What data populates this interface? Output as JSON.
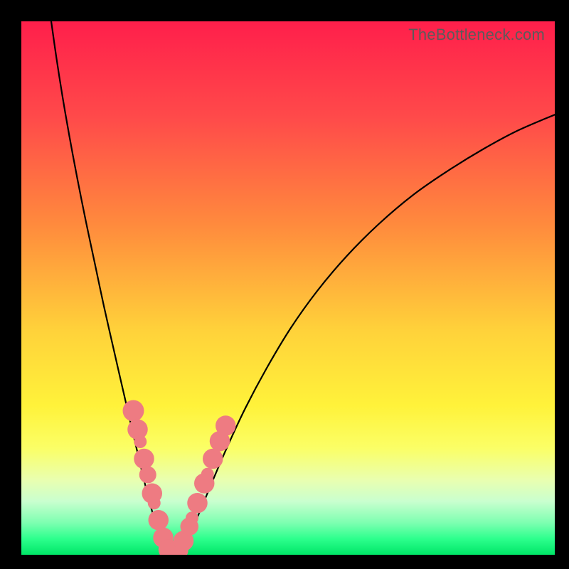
{
  "watermark": "TheBottleneck.com",
  "chart_data": {
    "type": "line",
    "title": "",
    "xlabel": "",
    "ylabel": "",
    "xlim": [
      0,
      100
    ],
    "ylim": [
      0,
      100
    ],
    "gradient_stops": [
      {
        "offset": 0.0,
        "color": "#ff1f4b"
      },
      {
        "offset": 0.18,
        "color": "#ff4a4a"
      },
      {
        "offset": 0.38,
        "color": "#ff8a3d"
      },
      {
        "offset": 0.58,
        "color": "#ffd23a"
      },
      {
        "offset": 0.72,
        "color": "#fff23a"
      },
      {
        "offset": 0.8,
        "color": "#fbff66"
      },
      {
        "offset": 0.86,
        "color": "#e9ffb0"
      },
      {
        "offset": 0.9,
        "color": "#c9ffcf"
      },
      {
        "offset": 0.94,
        "color": "#7dffb1"
      },
      {
        "offset": 0.97,
        "color": "#2dff8d"
      },
      {
        "offset": 1.0,
        "color": "#00e667"
      }
    ],
    "series": [
      {
        "name": "left_curve",
        "points": [
          {
            "x": 5.6,
            "y": 100.0
          },
          {
            "x": 6.6,
            "y": 93.0
          },
          {
            "x": 7.7,
            "y": 86.0
          },
          {
            "x": 9.0,
            "y": 78.5
          },
          {
            "x": 10.5,
            "y": 70.5
          },
          {
            "x": 12.1,
            "y": 62.5
          },
          {
            "x": 13.8,
            "y": 54.5
          },
          {
            "x": 15.5,
            "y": 46.5
          },
          {
            "x": 17.2,
            "y": 39.0
          },
          {
            "x": 18.8,
            "y": 32.0
          },
          {
            "x": 20.3,
            "y": 25.5
          },
          {
            "x": 21.7,
            "y": 19.5
          },
          {
            "x": 23.0,
            "y": 14.0
          },
          {
            "x": 24.2,
            "y": 9.3
          },
          {
            "x": 25.3,
            "y": 5.5
          },
          {
            "x": 26.2,
            "y": 2.7
          },
          {
            "x": 27.0,
            "y": 1.0
          },
          {
            "x": 27.8,
            "y": 0.2
          },
          {
            "x": 28.5,
            "y": 0.0
          }
        ]
      },
      {
        "name": "right_curve",
        "points": [
          {
            "x": 28.5,
            "y": 0.0
          },
          {
            "x": 29.3,
            "y": 0.2
          },
          {
            "x": 30.2,
            "y": 1.2
          },
          {
            "x": 31.5,
            "y": 3.5
          },
          {
            "x": 33.2,
            "y": 7.5
          },
          {
            "x": 35.5,
            "y": 13.0
          },
          {
            "x": 38.5,
            "y": 20.0
          },
          {
            "x": 42.0,
            "y": 27.5
          },
          {
            "x": 46.0,
            "y": 35.0
          },
          {
            "x": 50.5,
            "y": 42.5
          },
          {
            "x": 55.5,
            "y": 49.5
          },
          {
            "x": 61.0,
            "y": 56.0
          },
          {
            "x": 67.0,
            "y": 62.0
          },
          {
            "x": 73.5,
            "y": 67.5
          },
          {
            "x": 80.0,
            "y": 72.0
          },
          {
            "x": 86.5,
            "y": 76.0
          },
          {
            "x": 93.0,
            "y": 79.5
          },
          {
            "x": 100.0,
            "y": 82.5
          }
        ]
      }
    ],
    "markers": [
      {
        "x": 21.0,
        "y": 27.0,
        "r": 2.0
      },
      {
        "x": 21.8,
        "y": 23.5,
        "r": 1.9
      },
      {
        "x": 22.3,
        "y": 21.2,
        "r": 1.2
      },
      {
        "x": 23.0,
        "y": 18.0,
        "r": 1.9
      },
      {
        "x": 23.7,
        "y": 15.0,
        "r": 1.6
      },
      {
        "x": 24.5,
        "y": 11.5,
        "r": 1.9
      },
      {
        "x": 24.9,
        "y": 9.7,
        "r": 1.2
      },
      {
        "x": 25.7,
        "y": 6.5,
        "r": 1.9
      },
      {
        "x": 26.6,
        "y": 3.2,
        "r": 1.9
      },
      {
        "x": 27.6,
        "y": 1.0,
        "r": 1.9
      },
      {
        "x": 28.5,
        "y": 0.3,
        "r": 1.4
      },
      {
        "x": 29.4,
        "y": 0.9,
        "r": 1.9
      },
      {
        "x": 30.4,
        "y": 2.6,
        "r": 1.9
      },
      {
        "x": 31.5,
        "y": 5.3,
        "r": 1.7
      },
      {
        "x": 32.0,
        "y": 6.9,
        "r": 1.2
      },
      {
        "x": 33.0,
        "y": 9.7,
        "r": 1.9
      },
      {
        "x": 34.3,
        "y": 13.4,
        "r": 1.9
      },
      {
        "x": 34.9,
        "y": 15.1,
        "r": 1.2
      },
      {
        "x": 35.9,
        "y": 18.0,
        "r": 1.9
      },
      {
        "x": 37.2,
        "y": 21.3,
        "r": 1.9
      },
      {
        "x": 38.3,
        "y": 24.2,
        "r": 1.9
      }
    ],
    "marker_color": "#ee7b82"
  }
}
